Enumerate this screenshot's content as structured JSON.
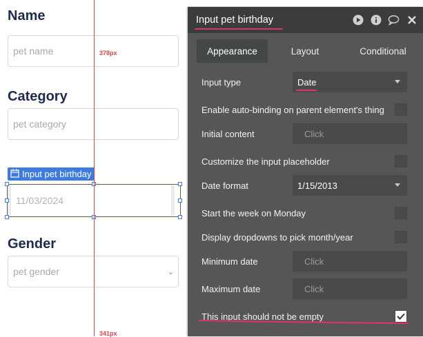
{
  "canvas": {
    "name": {
      "label": "Name",
      "placeholder": "pet name"
    },
    "category": {
      "label": "Category",
      "placeholder": "pet category"
    },
    "selected_element": {
      "tag": "Input pet birthday",
      "value": "11/03/2024"
    },
    "gender": {
      "label": "Gender",
      "placeholder": "pet gender"
    },
    "guides": {
      "top_distance": "378px",
      "bottom_distance": "341px"
    }
  },
  "panel": {
    "title": "Input pet birthday",
    "icons": [
      "play-icon",
      "info-icon",
      "comment-icon",
      "close-icon"
    ],
    "tabs": [
      {
        "label": "Appearance",
        "active": true
      },
      {
        "label": "Layout",
        "active": false
      },
      {
        "label": "Conditional",
        "active": false
      }
    ],
    "properties": {
      "input_type": {
        "label": "Input type",
        "value": "Date"
      },
      "auto_binding": {
        "label": "Enable auto-binding on parent element's thing",
        "checked": false
      },
      "initial_content": {
        "label": "Initial content",
        "placeholder": "Click"
      },
      "customize_placeholder": {
        "label": "Customize the input placeholder",
        "checked": false
      },
      "date_format": {
        "label": "Date format",
        "value": "1/15/2013"
      },
      "week_monday": {
        "label": "Start the week on Monday",
        "checked": false
      },
      "dropdowns_month_year": {
        "label": "Display dropdowns to pick month/year",
        "checked": false
      },
      "minimum_date": {
        "label": "Minimum date",
        "placeholder": "Click"
      },
      "maximum_date": {
        "label": "Maximum date",
        "placeholder": "Click"
      },
      "not_empty": {
        "label": "This input should not be empty",
        "checked": true
      }
    }
  },
  "colors": {
    "accent_pink": "#e0336b",
    "selection_blue": "#3e7bdb",
    "guide_red": "#d64545",
    "panel_bg": "#565656",
    "heading_navy": "#1f2a4d"
  }
}
